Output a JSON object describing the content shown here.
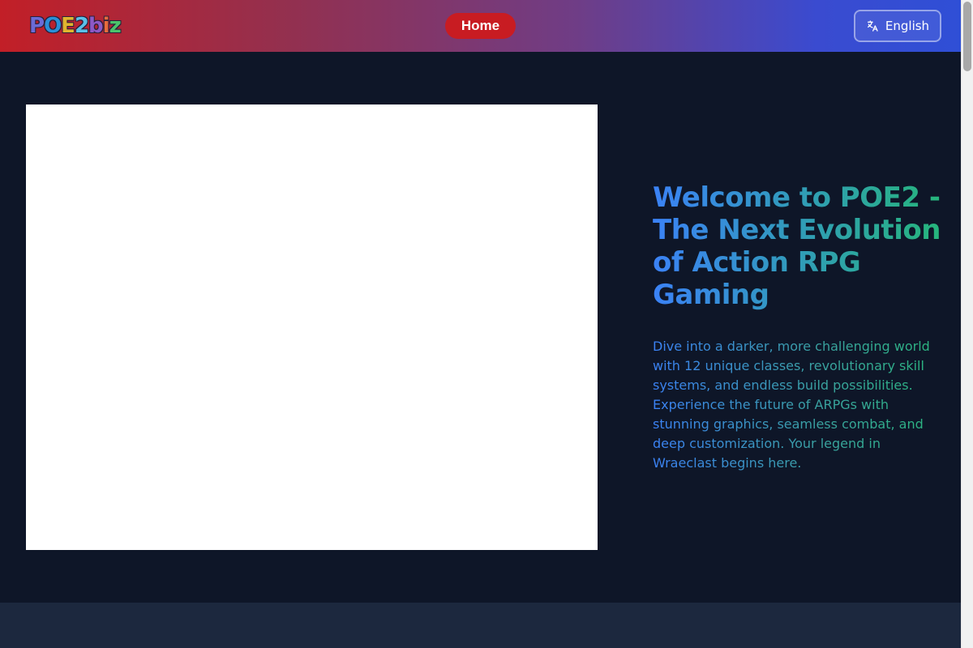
{
  "header": {
    "logo_text": "POE2biz",
    "nav": [
      {
        "label": "Home"
      }
    ],
    "language_label": "English",
    "gradient_colors": [
      "#c21f27",
      "#2f4fd6"
    ]
  },
  "hero": {
    "title": "Welcome to POE2 - The Next Evolution of Action RPG Gaming",
    "description": "Dive into a darker, more challenging world with 12 unique classes, revolutionary skill systems, and endless build possibilities. Experience the future of ARPGs with stunning graphics, seamless combat, and deep customization. Your legend in Wraeclast begins here.",
    "title_gradient": [
      "#3b82f6",
      "#26b67a"
    ]
  },
  "theme": {
    "page_background": "#0e1628",
    "accent_red": "#c81c22",
    "section_background": "#1c283e"
  },
  "icons": {
    "language": "translate-icon"
  }
}
